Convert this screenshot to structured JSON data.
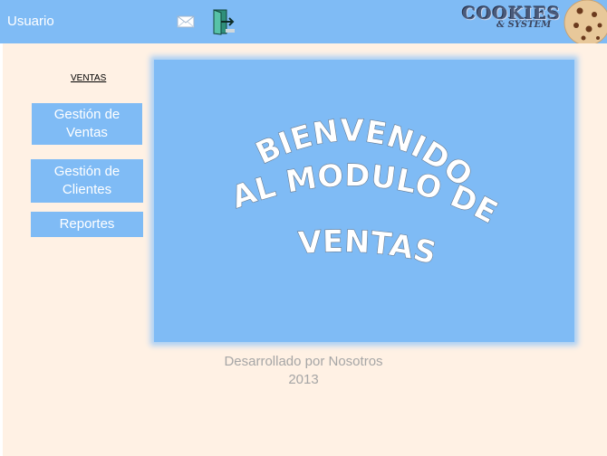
{
  "header": {
    "user_label": "Usuario",
    "icons": [
      "mail-icon",
      "exit-door-icon"
    ],
    "logo_text": "COOKIES",
    "logo_subtext": "& SYSTEM"
  },
  "sidebar": {
    "section_title": "VENTAS",
    "items": [
      {
        "label_line1": "Gestión de",
        "label_line2": "Ventas"
      },
      {
        "label_line1": "Gestión de",
        "label_line2": "Clientes"
      },
      {
        "label_line1": "Reportes",
        "label_line2": ""
      }
    ]
  },
  "banner": {
    "line1": "BIENVENIDO",
    "line2": "AL MODULO DE",
    "line3": "VENTAS"
  },
  "footer": {
    "line1": "Desarrollado por Nosotros",
    "line2": "2013"
  },
  "colors": {
    "accent": "#7fbbf5",
    "background": "#fff1e4",
    "footer_text": "#a6a6a6"
  }
}
